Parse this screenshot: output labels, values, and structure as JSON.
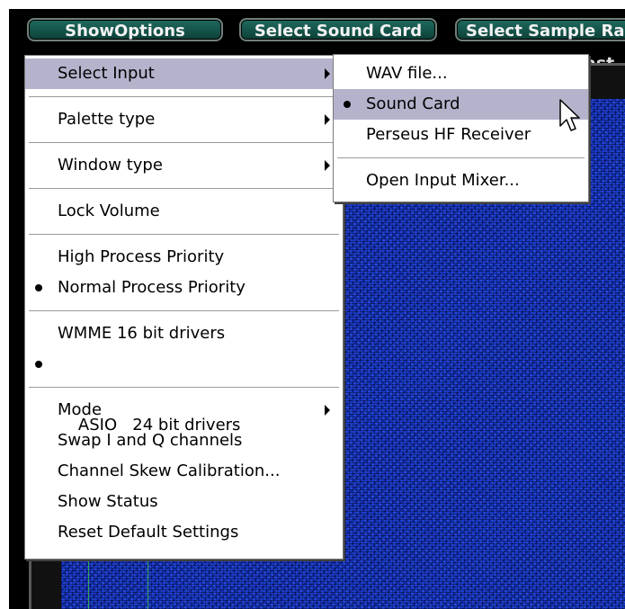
{
  "toolbar": {
    "show_options": "ShowOptions",
    "select_sound_card": "Select Sound Card",
    "select_sample_rate": "Select Sample Ra"
  },
  "subtitle": "ast",
  "main_menu": {
    "select_input": "Select Input",
    "palette_type": "Palette type",
    "window_type": "Window type",
    "lock_volume": "Lock Volume",
    "high_priority": "High Process Priority",
    "normal_priority": "Normal Process Priority",
    "wmme": "WMME 16 bit drivers",
    "asio": "ASIO   24 bit drivers",
    "mode": "Mode",
    "swap_iq": "Swap I and Q channels",
    "skew_cal": "Channel Skew Calibration...",
    "show_status": "Show Status",
    "reset_defaults": "Reset Default Settings"
  },
  "input_submenu": {
    "wav_file": "WAV file...",
    "sound_card": "Sound Card",
    "perseus": "Perseus HF Receiver",
    "open_mixer": "Open Input Mixer..."
  },
  "colors": {
    "menu_highlight": "#b5b3cc",
    "button_bg": "#0c3f37",
    "waterfall": "#1a3bd0"
  }
}
